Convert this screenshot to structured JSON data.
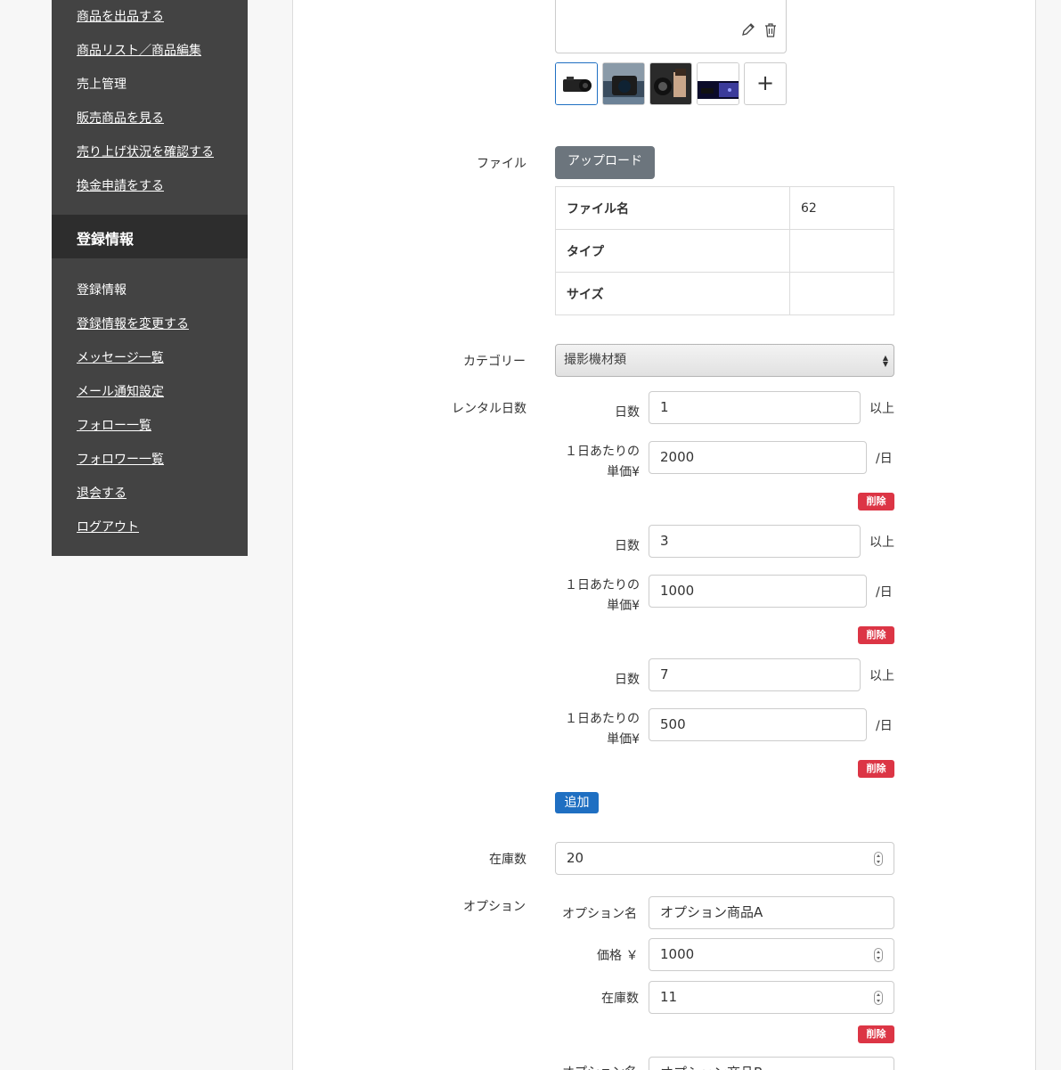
{
  "sidebar": {
    "top_links": [
      "商品を出品する",
      "商品リスト／商品編集",
      "売上管理",
      "販売商品を見る",
      "売り上げ状況を確認する",
      "換金申請をする"
    ],
    "section_title": "登録情報",
    "bottom_links": [
      "登録情報",
      "登録情報を変更する",
      "メッセージ一覧",
      "メール通知設定",
      "フォロー一覧",
      "フォロワー一覧",
      "退会する",
      "ログアウト"
    ]
  },
  "images": {
    "edit_icon": "pencil-icon",
    "delete_icon": "trash-icon",
    "add_label": "+"
  },
  "file": {
    "label": "ファイル",
    "upload_label": "アップロード",
    "rows": [
      {
        "key": "ファイル名",
        "value": "62"
      },
      {
        "key": "タイプ",
        "value": ""
      },
      {
        "key": "サイズ",
        "value": ""
      }
    ]
  },
  "category": {
    "label": "カテゴリー",
    "selected": "撮影機材類"
  },
  "rental": {
    "label": "レンタル日数",
    "days_label": "日数",
    "days_suffix": "以上",
    "price_label_1": "１日あたりの",
    "price_label_2": "単価¥",
    "price_suffix": "/日",
    "delete_label": "削除",
    "add_label": "追加",
    "tiers": [
      {
        "days": "1",
        "price": "2000"
      },
      {
        "days": "3",
        "price": "1000"
      },
      {
        "days": "7",
        "price": "500"
      }
    ]
  },
  "stock": {
    "label": "在庫数",
    "value": "20"
  },
  "option": {
    "label": "オプション",
    "name_label": "オプション名",
    "price_label": "価格 ￥",
    "stock_label": "在庫数",
    "delete_label": "削除",
    "items": [
      {
        "name": "オプション商品A",
        "price": "1000",
        "stock": "11"
      },
      {
        "name": "オプション商品B"
      }
    ]
  },
  "colors": {
    "sidebar_bg": "#434343",
    "sidebar_header_bg": "#2d2d2d",
    "danger": "#dc3545",
    "primary": "#1f6fc2",
    "secondary": "#6c757d"
  }
}
